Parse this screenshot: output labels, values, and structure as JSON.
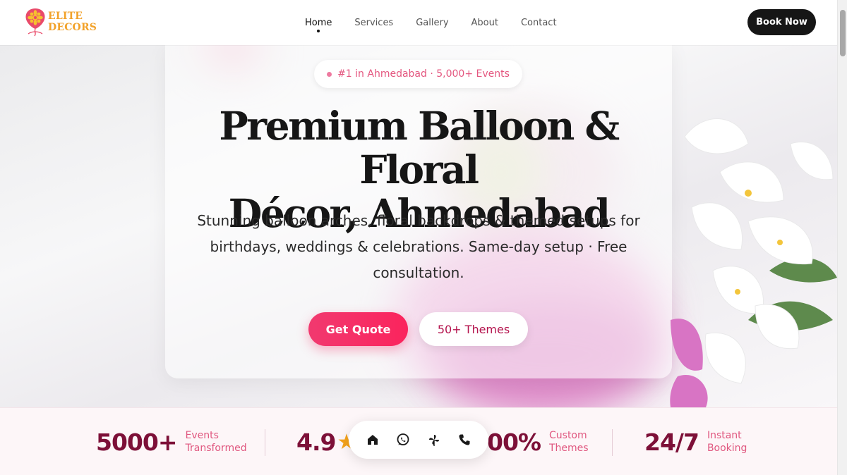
{
  "brand": {
    "line1": "ELITE",
    "line2": "DECORS",
    "color": "#f2a22a",
    "accent": "#e94a6a"
  },
  "nav": {
    "links": [
      {
        "label": "Home",
        "active": true
      },
      {
        "label": "Services"
      },
      {
        "label": "Gallery"
      },
      {
        "label": "About"
      },
      {
        "label": "Contact"
      }
    ],
    "cta": "Book Now"
  },
  "hero": {
    "badge": "#1 in Ahmedabad · 5,000+ Events",
    "title_line1": "Premium Balloon & Floral",
    "title_line2": "Décor, Ahmedabad",
    "subtitle": "Stunning balloon arches, floral backdrops & themed setups for birthdays, weddings & celebrations. Same-day setup · Free consultation.",
    "primary_cta": "Get Quote",
    "secondary_cta": "50+ Themes"
  },
  "stats": [
    {
      "value": "5000+",
      "label_line1": "Events",
      "label_line2": "Transformed"
    },
    {
      "value": "4.9",
      "star": "★",
      "label_line1": "",
      "label_line2": ""
    },
    {
      "value": "00%",
      "label_line1": "Custom",
      "label_line2": "Themes"
    },
    {
      "value": "24/7",
      "label_line1": "Instant",
      "label_line2": "Booking"
    }
  ],
  "dock": {
    "icons": [
      "home-icon",
      "whatsapp-icon",
      "pinwheel-icon",
      "phone-icon"
    ]
  },
  "colors": {
    "primary": "#f1396f",
    "stat_number": "#7d1038",
    "stat_label": "#e0577f",
    "star": "#f4a31c",
    "dark_button": "#161616"
  }
}
